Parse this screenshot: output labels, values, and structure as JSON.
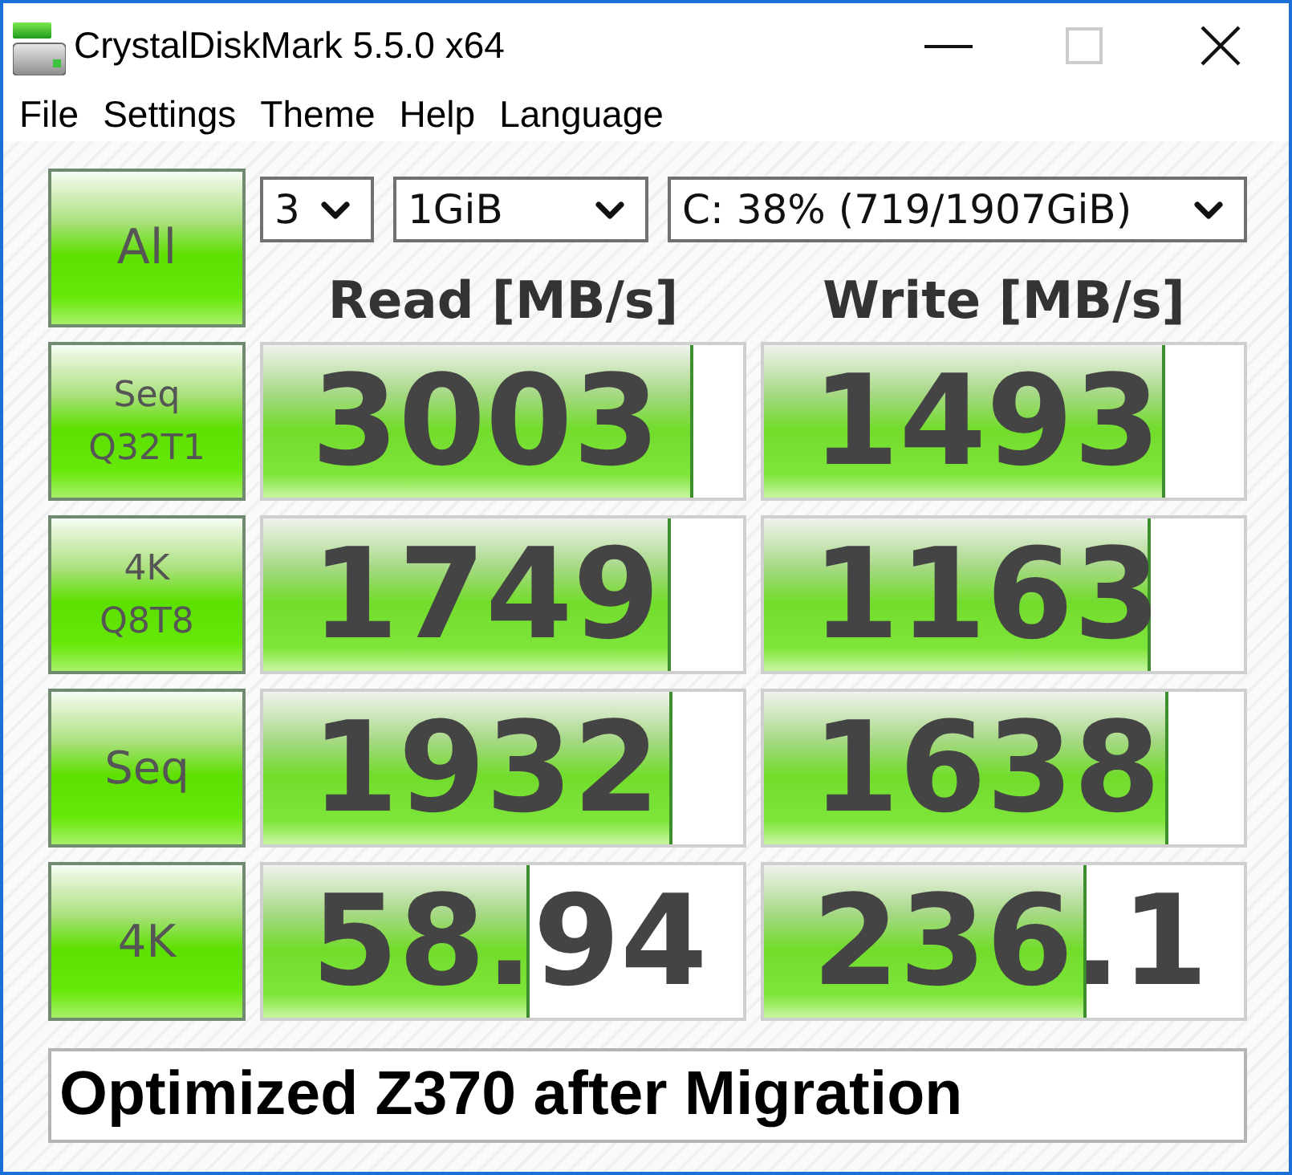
{
  "window": {
    "title": "CrystalDiskMark 5.5.0 x64",
    "maximize_disabled": true
  },
  "menu": [
    "File",
    "Settings",
    "Theme",
    "Help",
    "Language"
  ],
  "all_button": "All",
  "selectors": [
    {
      "kind": "count",
      "value": "3"
    },
    {
      "kind": "size",
      "value": "1GiB"
    },
    {
      "kind": "drive",
      "value": "C: 38% (719/1907GiB)"
    }
  ],
  "columns": [
    "Read [MB/s]",
    "Write [MB/s]"
  ],
  "tests": [
    {
      "label": [
        "Seq",
        "Q32T1"
      ],
      "read": {
        "value": "3003",
        "level": 0.896
      },
      "write": {
        "value": "1493",
        "level": 0.836
      }
    },
    {
      "label": [
        "4K",
        "Q8T8"
      ],
      "read": {
        "value": "1749",
        "level": 0.85
      },
      "write": {
        "value": "1163",
        "level": 0.806
      }
    },
    {
      "label": [
        "Seq"
      ],
      "read": {
        "value": "1932",
        "level": 0.853
      },
      "write": {
        "value": "1638",
        "level": 0.843
      }
    },
    {
      "label": [
        "4K"
      ],
      "read": {
        "value": "58.94",
        "level": 0.555
      },
      "write": {
        "value": "236.1",
        "level": 0.672
      }
    }
  ],
  "comment": "Optimized Z370 after Migration"
}
